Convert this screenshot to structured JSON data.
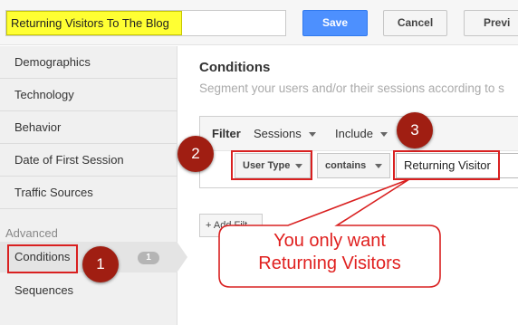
{
  "header": {
    "segment_name": "Returning Visitors To The Blog",
    "save_label": "Save",
    "cancel_label": "Cancel",
    "preview_label": "Previ"
  },
  "sidebar": {
    "items": [
      {
        "label": "Demographics"
      },
      {
        "label": "Technology"
      },
      {
        "label": "Behavior"
      },
      {
        "label": "Date of First Session"
      },
      {
        "label": "Traffic Sources"
      }
    ],
    "advanced_heading": "Advanced",
    "advanced_items": [
      {
        "label": "Conditions",
        "badge": "1",
        "active": true
      },
      {
        "label": "Sequences"
      }
    ]
  },
  "main": {
    "title": "Conditions",
    "subtitle": "Segment your users and/or their sessions according to s",
    "filter": {
      "label": "Filter",
      "scope": "Sessions",
      "mode": "Include",
      "dimension": "User Type",
      "operator": "contains",
      "value": "Returning Visitor"
    },
    "add_filter_label": "+ Add Filt"
  },
  "annotations": {
    "step1": "1",
    "step2": "2",
    "step3": "3",
    "callout_line1": "You only want",
    "callout_line2": "Returning Visitors"
  },
  "colors": {
    "accent_red": "#d92020",
    "circle_fill": "#a01e12",
    "highlight_yellow": "#ffff33",
    "save_blue": "#4d90fe"
  }
}
